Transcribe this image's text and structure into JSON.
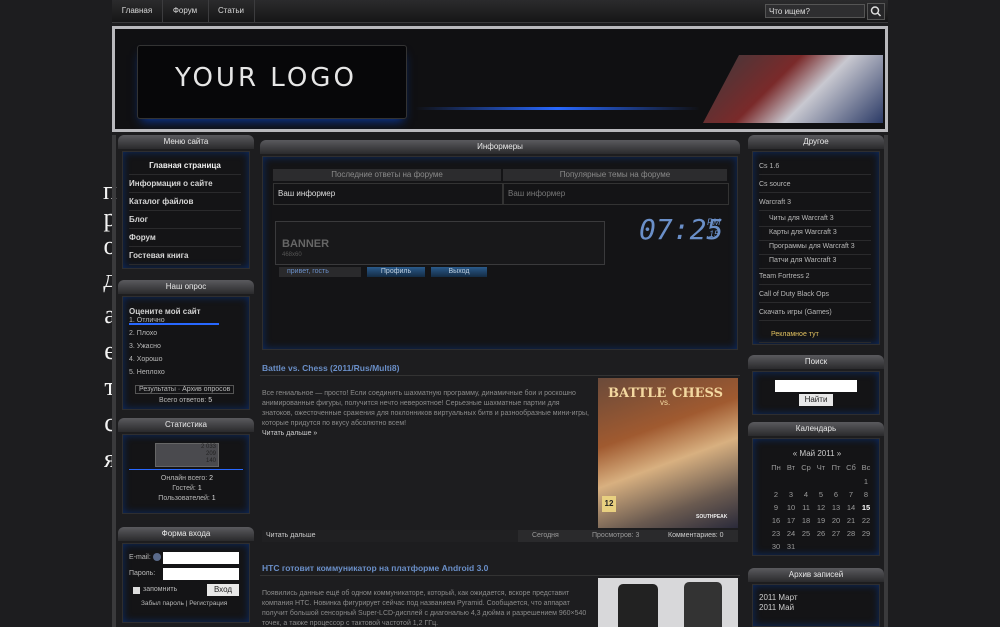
{
  "nav": {
    "items": [
      "Главная",
      "Форум",
      "Статьи"
    ],
    "search_placeholder": "Что ищем?"
  },
  "header": {
    "logo_text": "YOUR LOGO"
  },
  "vertical_text": [
    "п",
    "р",
    "о",
    "д",
    "а",
    "е",
    "т",
    "с",
    "я"
  ],
  "left": {
    "menu": {
      "title": "Меню сайта",
      "items": [
        "Главная страница",
        "Информация о сайте",
        "Каталог файлов",
        "Блог",
        "Форум",
        "Гостевая книга"
      ]
    },
    "poll": {
      "title": "Наш опрос",
      "question": "Оцените мой сайт",
      "options": [
        "1. Отлично",
        "2. Плохо",
        "3. Ужасно",
        "4. Хорошо",
        "5. Неплохо"
      ],
      "results_label": "Результаты",
      "archive_label": "Архив опросов",
      "total_label": "Всего ответов:",
      "total_value": "5"
    },
    "stats": {
      "title": "Статистика",
      "counter_values": [
        "2 033",
        "209",
        "140"
      ],
      "online_label": "Онлайн всего:",
      "online_value": "2",
      "guests_label": "Гостей:",
      "guests_value": "1",
      "users_label": "Пользователей:",
      "users_value": "1"
    },
    "login": {
      "title": "Форма входа",
      "email_label": "E-mail:",
      "password_label": "Пароль:",
      "remember_label": "запомнить",
      "submit_label": "Вход",
      "forgot_label": "Забыл пароль",
      "register_label": "Регистрация"
    }
  },
  "center": {
    "informers": {
      "title": "Информеры",
      "col1": "Последние ответы на форуме",
      "col2": "Популярные темы на форуме",
      "cell1": "Ваш информер",
      "cell2": "Ваш информер",
      "banner_title": "BANNER",
      "banner_size": "468x60",
      "clock_time": "07:25",
      "clock_ampm": "PM",
      "clock_sec": "15",
      "greeting_label": "привет,",
      "greeting_user": "гость",
      "btn2": "Профиль",
      "btn3": "Выход"
    },
    "article1": {
      "title": "Battle vs. Chess (2011/Rus/Multi8)",
      "text": "Все гениальное — просто! Если соединить шахматную программу, динамичные бои и роскошно анимированные фигуры, получится нечто невероятное! Серьезные шахматные партии для знатоков, ожесточенные сражения для поклонников виртуальных битв и разнообразные мини-игры, которые придутся по вкусу абсолютно всем!",
      "more_inline": "Читать дальше »",
      "more_label": "Читать дальше",
      "date_label": "Сегодня",
      "views_label": "Просмотров: 3",
      "comments_label": "Комментариев: 0",
      "img_title1": "BATTLE",
      "img_title2": "vs.",
      "img_title3": "CHESS",
      "img_rating": "12",
      "img_publisher": "SOUTHPEAK"
    },
    "article2": {
      "title": "HTC готовит коммуникатор на платформе Android 3.0",
      "text": "Появились данные ещё об одном коммуникаторе, который, как ожидается, вскоре представит компания HTC. Новинка фигурирует сейчас под названием Pyramid. Сообщается, что аппарат получит большой сенсорный Super-LCD-дисплей с диагональю 4,3 дюйма и разрешением 960×540 точек, а также процессор с тактовой частотой 1,2 ГГц."
    }
  },
  "right": {
    "other": {
      "title": "Другое",
      "items": [
        "Cs 1.6",
        "Cs source",
        "Warcraft 3",
        "Читы для Warcraft 3",
        "Карты для Warcraft 3",
        "Программы для Warcraft 3",
        "Патчи для Warcraft 3",
        "Team Fortress 2",
        "Call of Duty Black Ops",
        "Скачать игры (Games)"
      ],
      "ad_label": "Рекламное тут"
    },
    "search": {
      "title": "Поиск",
      "button_label": "Найти"
    },
    "calendar": {
      "title": "Календарь",
      "month": "Май 2011",
      "prev": "«",
      "next": "»",
      "weekdays": [
        "Пн",
        "Вт",
        "Ср",
        "Чт",
        "Пт",
        "Сб",
        "Вс"
      ],
      "days": [
        "1",
        "2",
        "3",
        "4",
        "5",
        "6",
        "7",
        "8",
        "9",
        "10",
        "11",
        "12",
        "13",
        "14",
        "15",
        "16",
        "17",
        "18",
        "19",
        "20",
        "21",
        "22",
        "23",
        "24",
        "25",
        "26",
        "27",
        "28",
        "29",
        "30",
        "31"
      ]
    },
    "archive": {
      "title": "Архив записей",
      "items": [
        "2011 Март",
        "2011 Май"
      ]
    }
  },
  "colors": {
    "accent": "#2868ff",
    "bg": "#1d1d1f",
    "panel": "#141416"
  }
}
